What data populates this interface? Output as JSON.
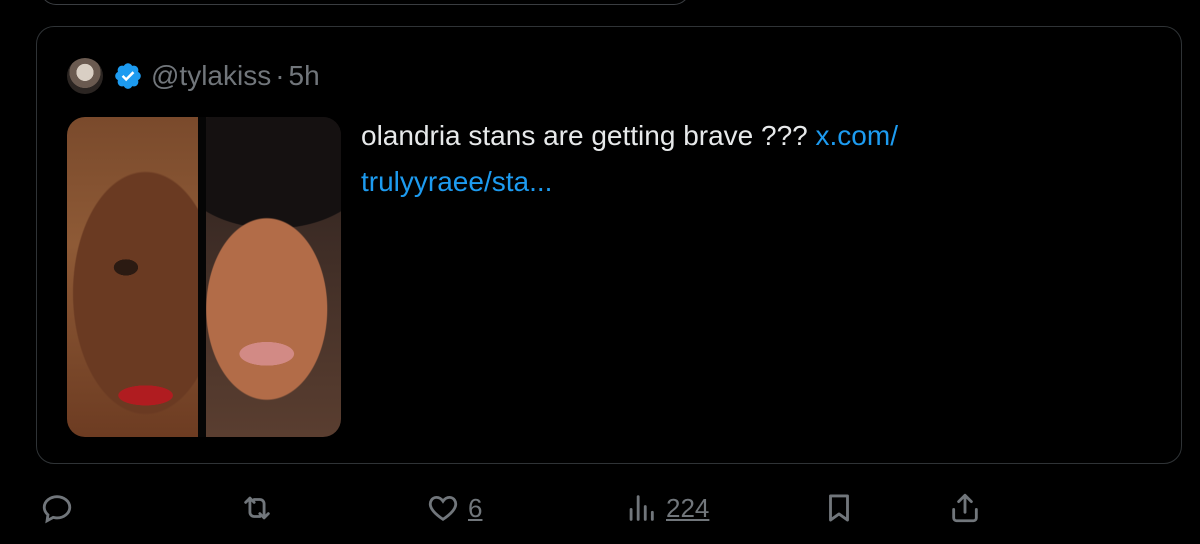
{
  "quoted_post": {
    "handle": "@tylakiss",
    "separator": "·",
    "time": "5h",
    "text": "olandria stans are getting brave ??? ",
    "link_text": "x.com/\ntrulyyraee/sta..."
  },
  "actions": {
    "likes": "6",
    "views": "224"
  },
  "colors": {
    "background": "#000000",
    "text": "#e7e9ea",
    "muted": "#71767b",
    "link": "#1d9bf0",
    "verified": "#1d9bf0",
    "border": "#2f3336"
  },
  "icons": [
    "verified-badge-icon",
    "reply-icon",
    "repost-icon",
    "like-icon",
    "views-icon",
    "bookmark-icon",
    "share-icon"
  ]
}
